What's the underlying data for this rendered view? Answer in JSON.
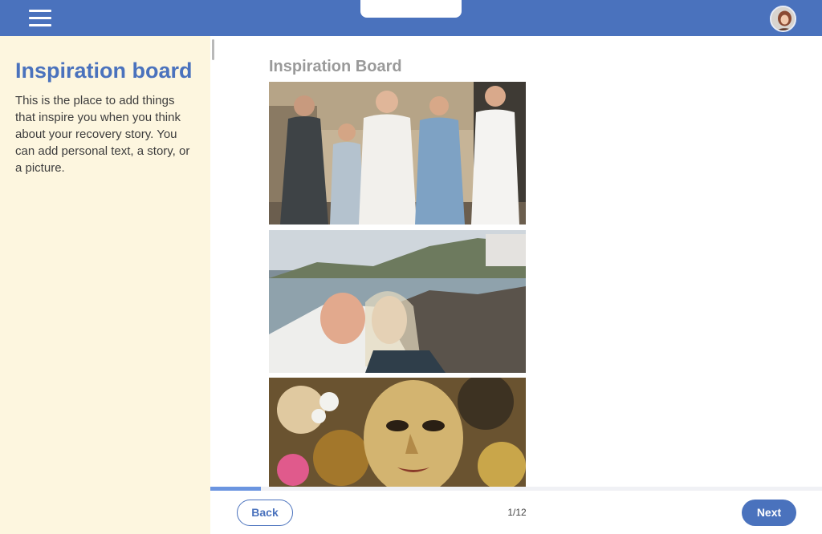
{
  "header": {
    "menu_icon": "hamburger-menu-icon",
    "avatar_icon": "user-avatar",
    "brand_color": "#4a72bd"
  },
  "sidebar": {
    "title": "Inspiration board",
    "description": "This is the place to add things that inspire you when you think about your recovery story. You can add personal text, a story, or a picture.",
    "background": "#fdf6df"
  },
  "board": {
    "heading": "Inspiration Board",
    "items": [
      {
        "type": "picture"
      },
      {
        "type": "picture"
      },
      {
        "type": "picture"
      }
    ]
  },
  "footer": {
    "back_label": "Back",
    "next_label": "Next",
    "page_counter": "1/12",
    "progress_fraction": 0.083
  }
}
